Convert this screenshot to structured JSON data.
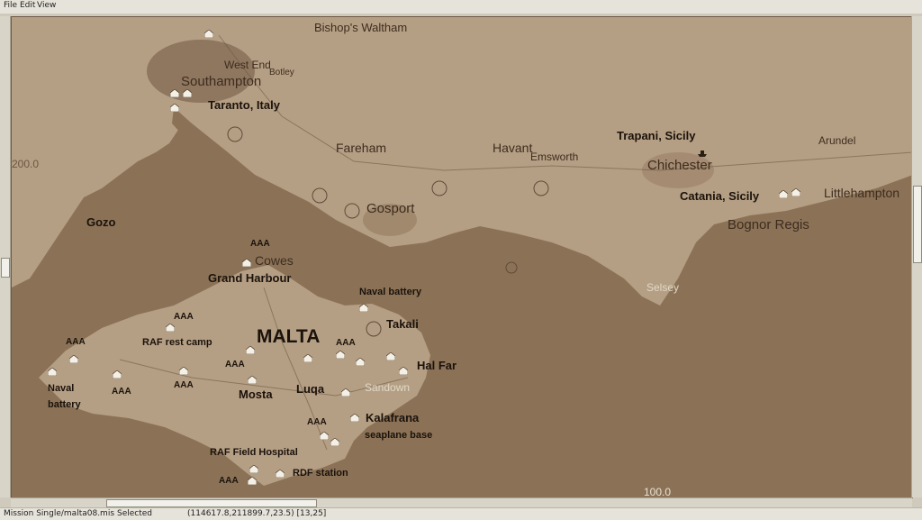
{
  "menu": {
    "file": "File",
    "edit": "Edit",
    "view": "View"
  },
  "map": {
    "grid_labels": {
      "left": "200.0",
      "bottom": "100.0"
    },
    "towns": [
      "Bishop's Waltham",
      "West End",
      "Botley",
      "Southampton",
      "Fareham",
      "Havant",
      "Emsworth",
      "Chichester",
      "Arundel",
      "Littlehampton",
      "Gosport",
      "Bognor Regis",
      "Cowes",
      "Selsey",
      "Sandown"
    ],
    "mission_labels": [
      "Taranto, Italy",
      "Trapani, Sicily",
      "Catania, Sicily",
      "Gozo",
      "AAA",
      "Grand Harbour",
      "Naval battery",
      "Takali",
      "MALTA",
      "RAF rest camp",
      "AAA",
      "AAA",
      "AAA",
      "AAA",
      "Hal Far",
      "AAA",
      "Naval",
      "battery",
      "AAA",
      "Mosta",
      "Luqa",
      "AAA",
      "Kalafrana",
      "seaplane base",
      "RAF Field Hospital",
      "RDF station",
      "AAA"
    ]
  },
  "status": {
    "mission": "Mission  Single/malta08.mis",
    "selected": "Selected",
    "coords": "(114617.8,211899.7,23.5) [13,25]"
  },
  "colors": {
    "sea": "#8b7257",
    "land": "#b59f84",
    "ink": "#1a120b"
  }
}
